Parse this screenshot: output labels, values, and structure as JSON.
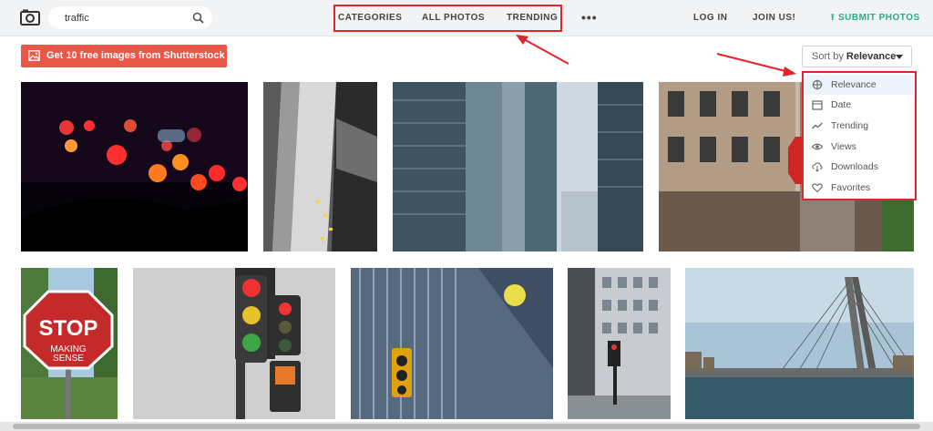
{
  "header": {
    "search_value": "traffic",
    "nav": [
      "CATEGORIES",
      "ALL PHOTOS",
      "TRENDING"
    ],
    "more": "•••",
    "login": "LOG IN",
    "join": "JOIN US!",
    "submit": "SUBMIT PHOTOS"
  },
  "promo": {
    "label": "Get 10 free images from Shutterstock →"
  },
  "sort": {
    "prefix": "Sort by",
    "selected": "Relevance"
  },
  "dropdown": {
    "items": [
      "Relevance",
      "Date",
      "Trending",
      "Views",
      "Downloads",
      "Favorites"
    ]
  },
  "colors": {
    "accent": "#e0262d",
    "submit": "#27ae85",
    "promo": "#e8574a"
  }
}
